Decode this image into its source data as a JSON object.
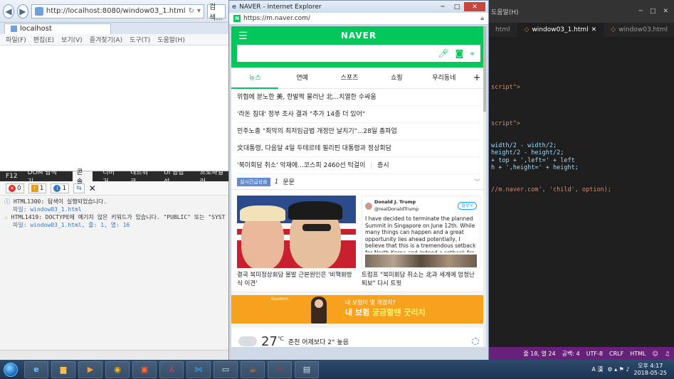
{
  "ie_left": {
    "url": "http://localhost:8080/window03_1.html",
    "search_placeholder": "검색...",
    "tab_title": "localhost",
    "menu": [
      "파일(F)",
      "편집(E)",
      "보기(V)",
      "즐겨찾기(A)",
      "도구(T)",
      "도움말(H)"
    ]
  },
  "f12": {
    "label": "F12",
    "tabs": [
      "DOM 탐색기",
      "콘솔",
      "디버거",
      "네트워크",
      "UI 응답성",
      "프로파일러"
    ],
    "errors": "0",
    "warnings": "1",
    "infos": "1",
    "console_lines": [
      "HTML1300: 탐색이 실행되었습니다.",
      "파일: window03_1.html",
      "HTML1419: DOCTYPE에 예기치 않은 키워드가 있습니다. \"PUBLIC\" 또는 \"SYSTEM\"이 필요합",
      "파일: window03_1.html, 줄: 1, 열: 16"
    ]
  },
  "popup": {
    "title": "NAVER - Internet Explorer",
    "url": "https://m.naver.com/",
    "logo": "NAVER",
    "tabs": [
      "뉴스",
      "연예",
      "스포츠",
      "쇼핑",
      "우리동네"
    ],
    "news": [
      "위협에 분노한 美, 한발짝 물러난 北...치열한 수싸움",
      "'라돈 침대' 정부 조사 결과 \"추가 14종 더 있어\"",
      "민주노총 \"최악의 최저임금법 개정안 날치기\"...28일 총파업",
      "文대통령, 다음달 4일 두테르테 필리핀 대통령과 정상회담",
      "'북미회담 취소' 악재에...코스피 2460선 턱걸이"
    ],
    "news_extra": "증시",
    "hot_tag": "실시간급상승",
    "hot_rank": "1",
    "hot_word": "문문",
    "card1_caption": "결국 북미정상회담 볼발 근본원인은 '비핵화방식 이견'",
    "tweet_name": "Donald J. Trump",
    "tweet_handle": "@realDonaldTrump",
    "tweet_follow": "팔로우",
    "tweet_text": "I have decided to terminate the planned Summit in Singapore on June 12th. While many things can happen and a great opportunity lies ahead potentially, I believe that this is a tremendous setback for North Korea and indeed a setback for the world.",
    "card2_caption": "트럼프 \"북미회담 취소는 北과 세계에 엄청난 퇴보\" 다시 트윗",
    "ad_question": "내 보험이 몇 개였지?",
    "ad_main": "내 보험 ",
    "ad_highlight": "궁금할땐 굿리치",
    "weather_temp": "27",
    "weather_unit": "℃",
    "weather_text": "춘천 어제보다 2° 높음"
  },
  "vscode": {
    "menu_help": "도움말(H)",
    "tabs": [
      "html",
      "window03_1.html",
      "window03.html"
    ],
    "code_lines": [
      "script\">",
      "",
      "",
      "",
      "",
      "script\">",
      "",
      "",
      "width/2 - width/2;",
      "height/2 - height/2;",
      " + top + ',left=' + left",
      "h + ',height=' + height;",
      "",
      "",
      "//m.naver.com', 'child', option);"
    ],
    "status": [
      "줄 18, 열 24",
      "공백: 4",
      "UTF-8",
      "CRLF",
      "HTML"
    ]
  },
  "taskbar": {
    "time": "오후 4:17",
    "date": "2018-05-25",
    "ime": "A 漢"
  },
  "colors": {
    "naver_green": "#03c75a",
    "vscode_status": "#68217a"
  }
}
